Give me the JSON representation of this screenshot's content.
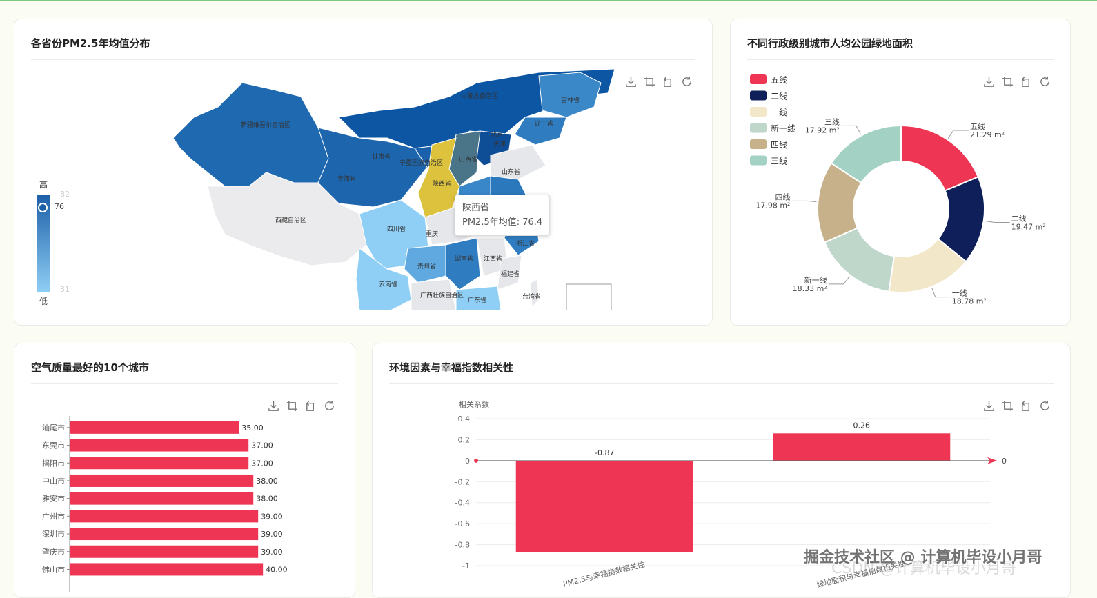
{
  "colors": {
    "accent": "#ee3553",
    "navy": "#0e1f5a",
    "cream": "#f2e7c8",
    "sage": "#bfd6cb",
    "tan": "#c7b18b",
    "mint": "#a3d2c4",
    "map_high": "#1c5fa8",
    "map_low": "#8fcff5",
    "map_gold": "#dcc23d"
  },
  "panels": {
    "map": {
      "title": "各省份PM2.5年均值分布"
    },
    "donut": {
      "title": "不同行政级别城市人均公园绿地面积"
    },
    "bars": {
      "title": "空气质量最好的10个城市"
    },
    "corr": {
      "title": "环境因素与幸福指数相关性"
    }
  },
  "toolbox": [
    "download-icon",
    "crop-icon",
    "undo-icon",
    "refresh-icon"
  ],
  "visual_map": {
    "high_label": "高",
    "low_label": "低",
    "max": "82",
    "min": "31",
    "current": "76"
  },
  "map_labels": [
    "新疆维吾尔自治区",
    "内蒙古自治区",
    "吉林省",
    "辽宁省",
    "甘肃省",
    "宁夏回族自治区",
    "山西省",
    "北京",
    "天津",
    "青海省",
    "山东省",
    "陕西省",
    "西藏自治区",
    "四川省",
    "重庆",
    "浙江省",
    "湖南省",
    "江西省",
    "贵州省",
    "福建省",
    "云南省",
    "广西壮族自治区",
    "广东省",
    "台湾省"
  ],
  "tooltip": {
    "region": "陕西省",
    "metric": "PM2.5年均值: 76.4"
  },
  "chart_data": [
    {
      "type": "pie",
      "title": "不同行政级别城市人均公园绿地面积",
      "unit": "m²",
      "legend": [
        "五线",
        "二线",
        "一线",
        "新一线",
        "四线",
        "三线"
      ],
      "slices": [
        {
          "name": "五线",
          "value": 21.29,
          "label": "21.29 m²"
        },
        {
          "name": "二线",
          "value": 19.47,
          "label": "19.47 m²"
        },
        {
          "name": "一线",
          "value": 18.78,
          "label": "18.78 m²"
        },
        {
          "name": "新一线",
          "value": 18.33,
          "label": "18.33 m²"
        },
        {
          "name": "四线",
          "value": 17.98,
          "label": "17.98 m²"
        },
        {
          "name": "三线",
          "value": 17.92,
          "label": "17.92 m²"
        }
      ]
    },
    {
      "type": "bar",
      "orientation": "horizontal",
      "title": "空气质量最好的10个城市",
      "categories": [
        "汕尾市",
        "东莞市",
        "揭阳市",
        "中山市",
        "雅安市",
        "广州市",
        "深圳市",
        "肇庆市",
        "佛山市"
      ],
      "values": [
        35.0,
        37.0,
        37.0,
        38.0,
        38.0,
        39.0,
        39.0,
        39.0,
        40.0
      ],
      "value_labels": [
        "35.00",
        "37.00",
        "37.00",
        "38.00",
        "38.00",
        "39.00",
        "39.00",
        "39.00",
        "40.00"
      ],
      "xlim": [
        0,
        48
      ]
    },
    {
      "type": "bar",
      "title": "环境因素与幸福指数相关性",
      "ylabel": "相关系数",
      "categories": [
        "PM2.5与幸福指数相关性",
        "绿地面积与幸福指数相关性"
      ],
      "values": [
        -0.87,
        0.26
      ],
      "value_labels": [
        "-0.87",
        "0.26"
      ],
      "ylim": [
        -1,
        0.4
      ],
      "yticks": [
        "0.4",
        "0.2",
        "0",
        "-0.2",
        "-0.4",
        "-0.6",
        "-0.8",
        "-1"
      ],
      "axis_end_label": "0"
    }
  ],
  "watermark": {
    "line1": "掘金技术社区 @ 计算机毕设小月哥",
    "line2": "CSDN @计算机毕设小月哥"
  }
}
